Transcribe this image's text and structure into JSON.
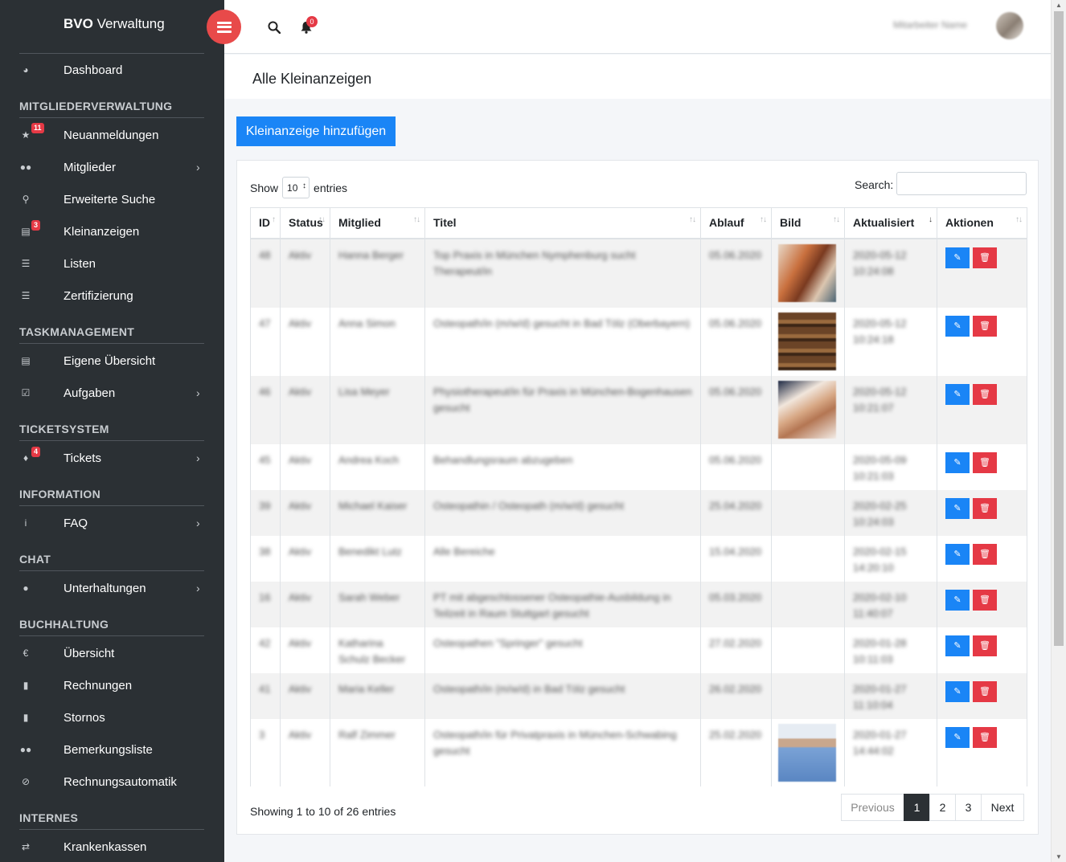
{
  "brand": {
    "bold": "BVO",
    "rest": " Verwaltung"
  },
  "topbar": {
    "notification_count": "0",
    "user_name": "Mitarbeiter Name"
  },
  "sidebar": {
    "dashboard": "Dashboard",
    "sections": [
      {
        "title": "MITGLIEDERVERWALTUNG"
      },
      {
        "title": "TASKMANAGEMENT"
      },
      {
        "title": "TICKETSYSTEM"
      },
      {
        "title": "INFORMATION"
      },
      {
        "title": "CHAT"
      },
      {
        "title": "BUCHHALTUNG"
      },
      {
        "title": "INTERNES"
      }
    ],
    "items": [
      {
        "label": "Neuanmeldungen",
        "icon": "star-icon",
        "badge": "11"
      },
      {
        "label": "Mitglieder",
        "icon": "users-icon"
      },
      {
        "label": "Erweiterte Suche",
        "icon": "search-icon"
      },
      {
        "label": "Kleinanzeigen",
        "icon": "money-icon",
        "badge": "3"
      },
      {
        "label": "Listen",
        "icon": "list-icon"
      },
      {
        "label": "Zertifizierung",
        "icon": "list-icon"
      },
      {
        "label": "Eigene Übersicht",
        "icon": "card-icon"
      },
      {
        "label": "Aufgaben",
        "icon": "check-square-icon"
      },
      {
        "label": "Tickets",
        "icon": "ticket-icon",
        "badge": "4"
      },
      {
        "label": "FAQ",
        "icon": "info-icon"
      },
      {
        "label": "Unterhaltungen",
        "icon": "comments-icon"
      },
      {
        "label": "Übersicht",
        "icon": "euro-icon"
      },
      {
        "label": "Rechnungen",
        "icon": "file-icon"
      },
      {
        "label": "Stornos",
        "icon": "file-icon"
      },
      {
        "label": "Bemerkungsliste",
        "icon": "users-icon"
      },
      {
        "label": "Rechnungsautomatik",
        "icon": "ban-icon"
      },
      {
        "label": "Krankenkassen",
        "icon": "exchange-icon"
      }
    ]
  },
  "page": {
    "title": "Alle Kleinanzeigen",
    "add_button": "Kleinanzeige hinzufügen"
  },
  "table": {
    "show_label": "Show",
    "show_value": "10",
    "entries_label": "entries",
    "search_label": "Search:",
    "columns": [
      "ID",
      "Status",
      "Mitglied",
      "Titel",
      "Ablauf",
      "Bild",
      "Aktualisiert",
      "Aktionen"
    ],
    "rows": [
      {
        "id": "48",
        "status": "Aktiv",
        "member": "Hanna Berger",
        "title": "Top Praxis in München Nymphenburg sucht Therapeut/in",
        "expiry": "05.06.2020",
        "updated": "2020-05-12 10:24:08",
        "image": "woman"
      },
      {
        "id": "47",
        "status": "Aktiv",
        "member": "Anna Simon",
        "title": "Osteopath/in (m/w/d) gesucht in Bad Tölz (Oberbayern)",
        "expiry": "05.06.2020",
        "updated": "2020-05-12 10:24:18",
        "image": "books"
      },
      {
        "id": "46",
        "status": "Aktiv",
        "member": "Lisa Meyer",
        "title": "Physiotherapeut/in für Praxis in München-Bogenhausen gesucht",
        "expiry": "05.06.2020",
        "updated": "2020-05-12 10:21:07",
        "image": "hands"
      },
      {
        "id": "45",
        "status": "Aktiv",
        "member": "Andrea Koch",
        "title": "Behandlungsraum abzugeben",
        "expiry": "05.06.2020",
        "updated": "2020-05-09 10:21:03",
        "image": ""
      },
      {
        "id": "39",
        "status": "Aktiv",
        "member": "Michael Kaiser",
        "title": "Osteopathin / Osteopath (m/w/d) gesucht",
        "expiry": "25.04.2020",
        "updated": "2020-02-25 10:24:03",
        "image": ""
      },
      {
        "id": "38",
        "status": "Aktiv",
        "member": "Benedikt Lutz",
        "title": "Alle Bereiche",
        "expiry": "15.04.2020",
        "updated": "2020-02-15 14:20:10",
        "image": ""
      },
      {
        "id": "16",
        "status": "Aktiv",
        "member": "Sarah Weber",
        "title": "PT mit abgeschlossener Osteopathie-Ausbildung in Teilzeit in Raum Stuttgart gesucht",
        "expiry": "05.03.2020",
        "updated": "2020-02-10 11:40:07",
        "image": ""
      },
      {
        "id": "42",
        "status": "Aktiv",
        "member": "Katharina Schulz Becker",
        "title": "Osteopathen \"Springer\" gesucht",
        "expiry": "27.02.2020",
        "updated": "2020-01-28 10:11:03",
        "image": ""
      },
      {
        "id": "41",
        "status": "Aktiv",
        "member": "Maria Keller",
        "title": "Osteopath/in (m/w/d) in Bad Tölz gesucht",
        "expiry": "26.02.2020",
        "updated": "2020-01-27 11:10:04",
        "image": ""
      },
      {
        "id": "3",
        "status": "Aktiv",
        "member": "Ralf Zimmer",
        "title": "Osteopath/in für Privatpraxis in München-Schwabing gesucht",
        "expiry": "25.02.2020",
        "updated": "2020-01-27 14:44:02",
        "image": "man"
      }
    ],
    "info": "Showing 1 to 10 of 26 entries",
    "pagination": {
      "prev": "Previous",
      "pages": [
        "1",
        "2",
        "3"
      ],
      "next": "Next",
      "active": "1"
    }
  }
}
